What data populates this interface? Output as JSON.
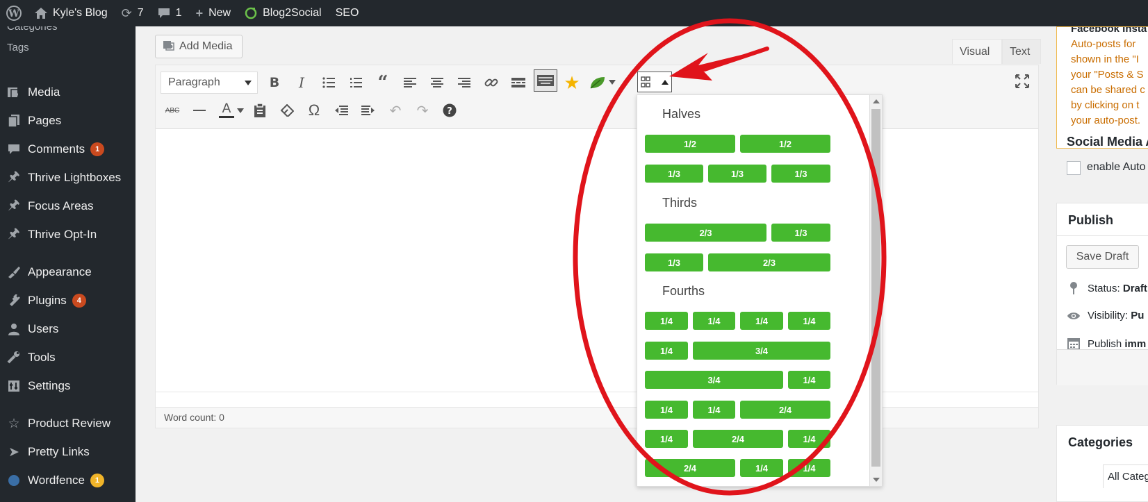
{
  "adminbar": {
    "site_name": "Kyle's Blog",
    "updates_count": "7",
    "comments_count": "1",
    "new_label": "New",
    "blog2social_label": "Blog2Social",
    "seo_label": "SEO"
  },
  "sidebar": {
    "cut_off_top": "Categories",
    "tags": "Tags",
    "items": [
      {
        "label": "Media",
        "icon": "media-icon"
      },
      {
        "label": "Pages",
        "icon": "pages-icon"
      },
      {
        "label": "Comments",
        "icon": "comments-icon",
        "badge": "1"
      },
      {
        "label": "Thrive Lightboxes",
        "icon": "pin-icon"
      },
      {
        "label": "Focus Areas",
        "icon": "pin-icon"
      },
      {
        "label": "Thrive Opt-In",
        "icon": "pin-icon"
      },
      {
        "label": "Appearance",
        "icon": "appearance-icon"
      },
      {
        "label": "Plugins",
        "icon": "plugins-icon",
        "badge": "4"
      },
      {
        "label": "Users",
        "icon": "users-icon"
      },
      {
        "label": "Tools",
        "icon": "tools-icon"
      },
      {
        "label": "Settings",
        "icon": "settings-icon"
      },
      {
        "label": "Product Review",
        "icon": "star-icon"
      },
      {
        "label": "Pretty Links",
        "icon": "pretty-links-icon"
      },
      {
        "label": "Wordfence",
        "icon": "wordfence-icon",
        "badge": "1"
      }
    ]
  },
  "editor": {
    "add_media": "Add Media",
    "tab_visual": "Visual",
    "tab_text": "Text",
    "format_select": "Paragraph",
    "word_count": "Word count: 0",
    "strike_label": "ABC",
    "text_color_label": "A"
  },
  "grid_panel": {
    "sections": [
      {
        "title": "Halves",
        "rows": [
          [
            "1/2",
            "1/2"
          ],
          [
            "1/3",
            "1/3",
            "1/3"
          ]
        ]
      },
      {
        "title": "Thirds",
        "rows": [
          [
            "2/3",
            "1/3"
          ],
          [
            "1/3",
            "2/3"
          ]
        ]
      },
      {
        "title": "Fourths",
        "rows": [
          [
            "1/4",
            "1/4",
            "1/4",
            "1/4"
          ],
          [
            "1/4",
            "3/4"
          ],
          [
            "3/4",
            "1/4"
          ],
          [
            "1/4",
            "1/4",
            "2/4"
          ],
          [
            "1/4",
            "2/4",
            "1/4"
          ],
          [
            "2/4",
            "1/4",
            "1/4"
          ]
        ]
      }
    ]
  },
  "right": {
    "notice_title": "Facebook Insta",
    "notice_lines": [
      "Auto-posts for",
      "shown in the \"I",
      "your \"Posts & S",
      "can be shared c",
      "by clicking on t",
      "your auto-post."
    ],
    "sma_title": "Social Media A",
    "sma_label": "enable Auto",
    "publish_title": "Publish",
    "save_draft": "Save Draft",
    "status_label": "Status:",
    "status_value": "Draft",
    "visibility_label": "Visibility:",
    "visibility_value": "Pu",
    "publish_label": "Publish",
    "publish_value": "imm",
    "categories_title": "Categories",
    "all_categories": "All Categ"
  },
  "colors": {
    "adminbar_bg": "#23282d",
    "green_button": "#46b92f",
    "annotation_red": "#e0141b",
    "badge": "#ca4a1f"
  }
}
